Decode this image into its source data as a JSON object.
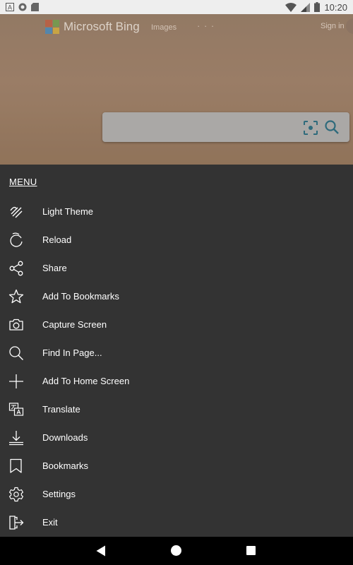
{
  "status_bar": {
    "time": "10:20",
    "left_icons": [
      "a-box-icon",
      "circle-app-icon",
      "sd-card-icon"
    ],
    "right_icons": [
      "wifi-icon",
      "signal-icon",
      "battery-icon"
    ]
  },
  "webpage": {
    "brand": "Microsoft Bing",
    "nav_images": "Images",
    "nav_more": "· · ·",
    "signin": "Sign in"
  },
  "menu": {
    "title": "MENU",
    "items": [
      {
        "label": "Light Theme",
        "icon": "theme-toggle-icon"
      },
      {
        "label": "Reload",
        "icon": "reload-icon"
      },
      {
        "label": "Share",
        "icon": "share-icon"
      },
      {
        "label": "Add To Bookmarks",
        "icon": "star-icon"
      },
      {
        "label": "Capture Screen",
        "icon": "camera-icon"
      },
      {
        "label": "Find In Page...",
        "icon": "search-icon"
      },
      {
        "label": "Add To Home Screen",
        "icon": "plus-icon"
      },
      {
        "label": "Translate",
        "icon": "translate-icon"
      },
      {
        "label": "Downloads",
        "icon": "download-icon"
      },
      {
        "label": "Bookmarks",
        "icon": "bookmark-icon"
      },
      {
        "label": "Settings",
        "icon": "gear-icon"
      },
      {
        "label": "Exit",
        "icon": "exit-icon"
      }
    ]
  },
  "colors": {
    "menu_bg": "#333333",
    "status_bg": "#eeeeee",
    "nav_bg": "#000000",
    "accent": "#3d7585"
  }
}
